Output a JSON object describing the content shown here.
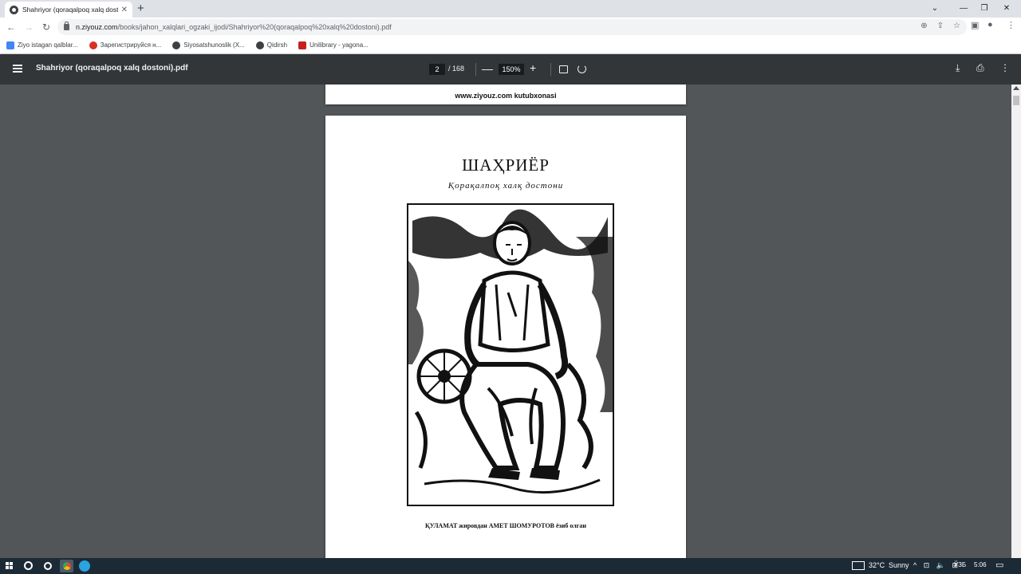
{
  "browser": {
    "tab": {
      "title": "Shahriyor (qoraqalpoq xalq dost",
      "close": "✕"
    },
    "new_tab": "+",
    "window_controls": [
      "⌄",
      "—",
      "❐",
      "✕"
    ],
    "address": {
      "host": "n.ziyouz.com",
      "path": "/books/jahon_xalqlari_ogzaki_ijodi/Shahriyor%20(qoraqalpoq%20xalq%20dostoni).pdf"
    },
    "nav": {
      "back": "←",
      "forward": "→",
      "reload": "↻"
    },
    "omnibox_icons": [
      "⊕",
      "⇪",
      "☆"
    ],
    "toolbar_icons": [
      "▣",
      "●",
      "⋮"
    ]
  },
  "bookmarks": [
    {
      "label": "Ziyo istagan qalblar...",
      "color": "#4285f4"
    },
    {
      "label": "Зарегистрируйся н...",
      "color": "#d93025"
    },
    {
      "label": "Siyosatshunoslik (X...",
      "color": "#3c4043"
    },
    {
      "label": "Qidirsh",
      "color": "#3c4043"
    },
    {
      "label": "Unilibrary - yagona...",
      "color": "#c5221f"
    }
  ],
  "pdf_viewer": {
    "filename": "Shahriyor (qoraqalpoq xalq dostoni).pdf",
    "page_current": "2",
    "page_total": "/ 168",
    "zoom": "150%",
    "zoom_out": "—",
    "zoom_in": "+",
    "right_icons": [
      "⤓",
      "⎙",
      "⋮"
    ]
  },
  "document": {
    "prev_page_footer": "www.ziyouz.com kutubxonasi",
    "book_title": "ШАҲРИЁР",
    "subtitle": "Қорақалпоқ  халқ  достони",
    "credit": "ҚУЛАМАТ жиров​дан АМЕТ ШОМУРОТОВ ёзиб олган"
  },
  "taskbar": {
    "weather_temp": "32°C",
    "weather_text": "Sunny",
    "tray_icons": "^ ⊡ 🔈 ⊞",
    "language": "ЎЗБ",
    "time": "5:06",
    "notification": "▭"
  }
}
